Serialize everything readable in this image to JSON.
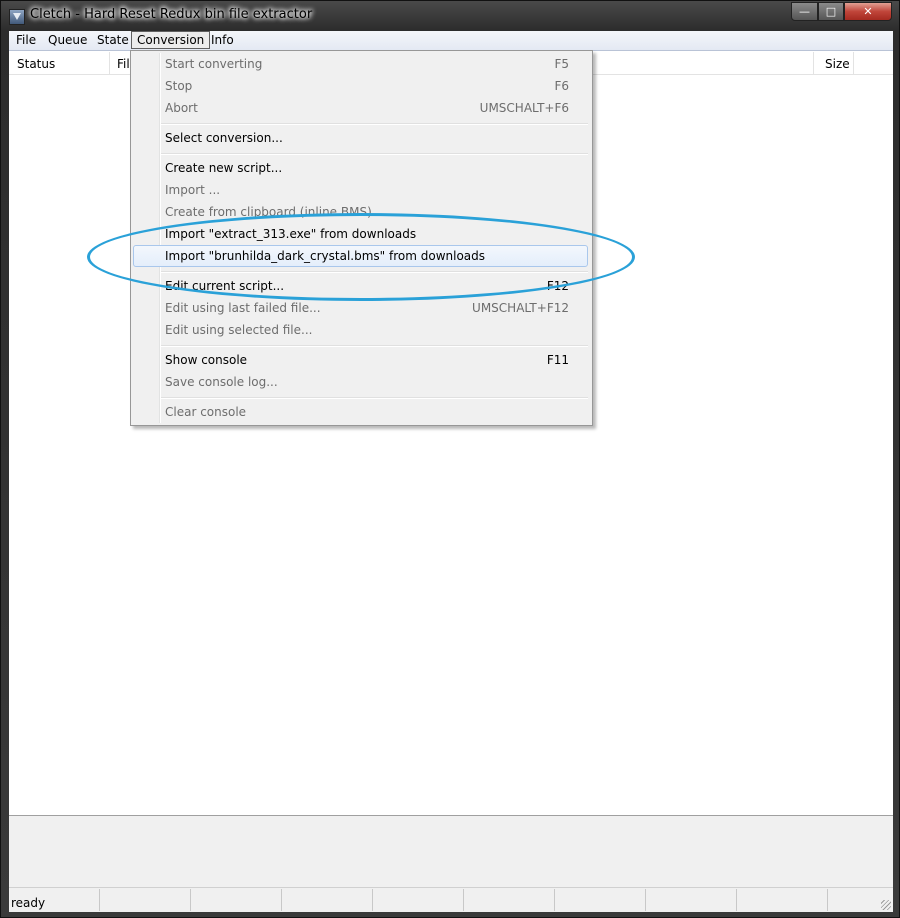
{
  "window": {
    "title": "Cletch - Hard Reset Redux bin file extractor",
    "controls": {
      "minimize": "—",
      "maximize": "□",
      "close": "✕"
    },
    "accent": "#2aa1d8"
  },
  "menubar": {
    "items": [
      {
        "label": "File"
      },
      {
        "label": "Queue"
      },
      {
        "label": "State"
      },
      {
        "label": "Conversion"
      },
      {
        "label": "Info"
      }
    ]
  },
  "list": {
    "columns": [
      {
        "label": "Status"
      },
      {
        "label": "Fil"
      },
      {
        "label": "Size"
      }
    ]
  },
  "conversion_menu": {
    "items": [
      {
        "label": "Start converting",
        "shortcut": "F5",
        "enabled": false
      },
      {
        "label": "Stop",
        "shortcut": "F6",
        "enabled": false
      },
      {
        "label": "Abort",
        "shortcut": "UMSCHALT+F6",
        "enabled": false
      },
      {
        "label": "Select conversion...",
        "shortcut": "",
        "enabled": true
      },
      {
        "label": "Create new script...",
        "shortcut": "",
        "enabled": true
      },
      {
        "label": "Import ...",
        "shortcut": "",
        "enabled": false
      },
      {
        "label": "Create from clipboard (inline BMS)",
        "shortcut": "",
        "enabled": false
      },
      {
        "label": "Import \"extract_313.exe\" from downloads",
        "shortcut": "",
        "enabled": true
      },
      {
        "label": "Import \"brunhilda_dark_crystal.bms\" from downloads",
        "shortcut": "",
        "enabled": true,
        "highlighted": true
      },
      {
        "label": "Edit current script...",
        "shortcut": "F12",
        "enabled": true
      },
      {
        "label": "Edit using last failed file...",
        "shortcut": "UMSCHALT+F12",
        "enabled": false
      },
      {
        "label": "Edit using selected file...",
        "shortcut": "",
        "enabled": false
      },
      {
        "label": "Show console",
        "shortcut": "F11",
        "enabled": true
      },
      {
        "label": "Save console log...",
        "shortcut": "",
        "enabled": false
      },
      {
        "label": "Clear console",
        "shortcut": "",
        "enabled": false
      }
    ]
  },
  "statusbar": {
    "text": "ready"
  }
}
